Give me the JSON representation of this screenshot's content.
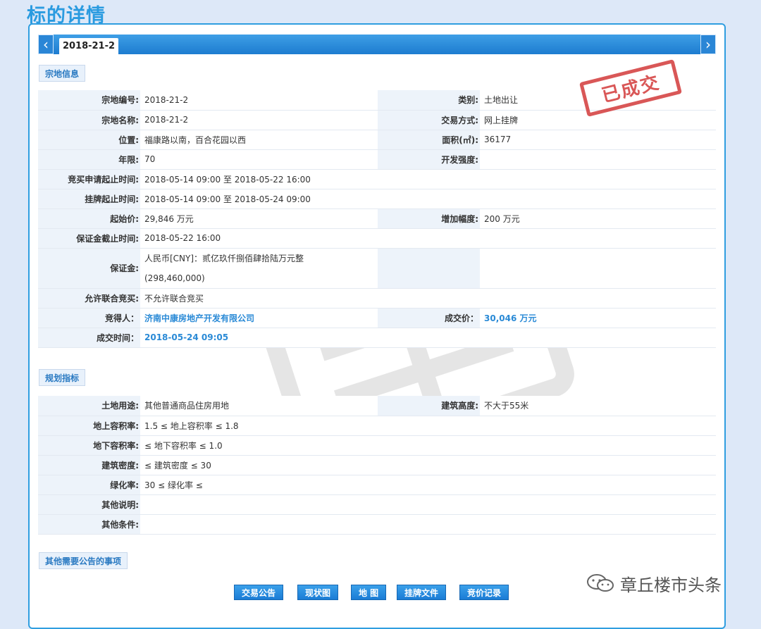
{
  "page": {
    "title": "标的详情"
  },
  "tab": {
    "active_label": "2018-21-2",
    "prev_arrow": "‹",
    "next_arrow": "›"
  },
  "stamp": {
    "text": "已成交"
  },
  "parcel_section": {
    "heading": "宗地信息",
    "rows": [
      {
        "k1": "宗地编号:",
        "v1": "2018-21-2",
        "k2": "类别:",
        "v2": "土地出让"
      },
      {
        "k1": "宗地名称:",
        "v1": "2018-21-2",
        "k2": "交易方式:",
        "v2": "网上挂牌"
      },
      {
        "k1": "位置:",
        "v1": "福康路以南，百合花园以西",
        "k2": "面积(㎡):",
        "v2": "36177"
      },
      {
        "k1": "年限:",
        "v1": "70",
        "k2": "开发强度:",
        "v2": ""
      },
      {
        "k1": "竞买申请起止时间:",
        "v1": "2018-05-14 09:00 至 2018-05-22 16:00"
      },
      {
        "k1": "挂牌起止时间:",
        "v1": "2018-05-14 09:00 至 2018-05-24 09:00"
      },
      {
        "k1": "起始价:",
        "v1": "29,846 万元",
        "k2": "增加幅度:",
        "v2": "200 万元"
      },
      {
        "k1": "保证金截止时间:",
        "v1": "2018-05-22 16:00"
      },
      {
        "k1": "保证金:",
        "v1a": "人民币[CNY]：贰亿玖仟捌佰肆拾陆万元整",
        "v1b": "(298,460,000)"
      },
      {
        "k1": "允许联合竞买:",
        "v1": "不允许联合竞买"
      },
      {
        "k1": "竞得人：",
        "v1": "济南中康房地产开发有限公司",
        "k2": "成交价：",
        "v2": "30,046 万元"
      },
      {
        "k1": "成交时间：",
        "v1": "2018-05-24 09:05"
      }
    ]
  },
  "planning_section": {
    "heading": "规划指标",
    "rows": [
      {
        "k1": "土地用途:",
        "v1": "其他普通商品住房用地",
        "k2": "建筑高度:",
        "v2": "不大于55米"
      },
      {
        "k1": "地上容积率:",
        "v1": "1.5 ≤ 地上容积率 ≤ 1.8"
      },
      {
        "k1": "地下容积率:",
        "v1": "≤ 地下容积率 ≤ 1.0"
      },
      {
        "k1": "建筑密度:",
        "v1": "≤ 建筑密度 ≤ 30"
      },
      {
        "k1": "绿化率:",
        "v1": "30 ≤ 绿化率 ≤"
      },
      {
        "k1": "其他说明:",
        "v1": ""
      },
      {
        "k1": "其他条件:",
        "v1": ""
      }
    ]
  },
  "other_section": {
    "heading": "其他需要公告的事项"
  },
  "buttons": {
    "announcement": "交易公告",
    "status_map": "现状图",
    "map": "地 图",
    "listing_docs": "挂牌文件",
    "bid_records": "竞价记录"
  },
  "brand": {
    "text": "章丘楼市头条"
  }
}
